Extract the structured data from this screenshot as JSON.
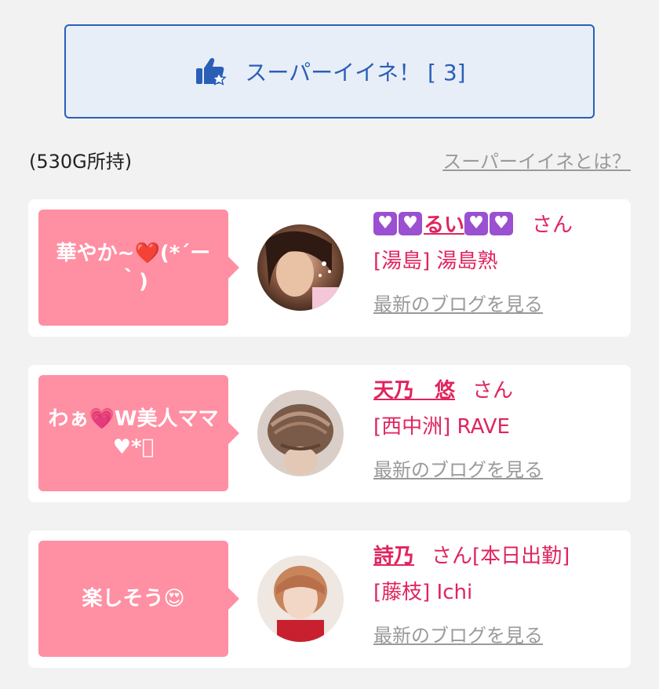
{
  "super_button": {
    "label": "スーパーイイネ！ [ 3]",
    "icon": "thumbs-up-star-icon",
    "color": "#2a5fb8"
  },
  "gold": "(530G所持)",
  "what_link": "スーパーイイネとは？",
  "cards": [
    {
      "message": "華やか~❤️(*´ー｀)",
      "name_pre": "💟💟",
      "name": "るい",
      "name_post": "💟💟",
      "honorific": "さん",
      "status": "",
      "shop": "[湯島] 湯島熟",
      "blog": "最新のブログを見る"
    },
    {
      "message": "わぁ💗W美人ママ♥︎*ﾟ",
      "name_pre": "",
      "name": "天乃　悠",
      "name_post": "",
      "honorific": "さん",
      "status": "",
      "shop": "[西中洲] RAVE",
      "blog": "最新のブログを見る"
    },
    {
      "message": "楽しそう😍",
      "name_pre": "",
      "name": "詩乃",
      "name_post": "",
      "honorific": "さん",
      "status": "[本日出勤]",
      "shop": "[藤枝] Ichi",
      "blog": "最新のブログを見る"
    }
  ],
  "colors": {
    "accent_pink": "#e0245e",
    "bubble_pink": "#ff8fa3",
    "link_gray": "#9a9a9a",
    "background": "#f2f2f2"
  }
}
